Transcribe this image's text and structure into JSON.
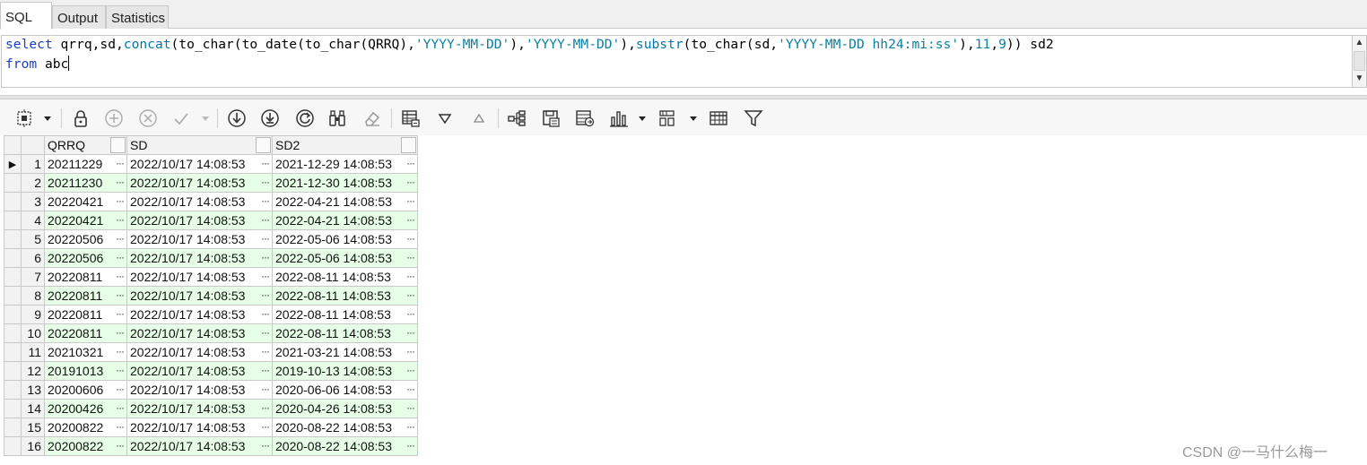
{
  "tabs": [
    {
      "label": "SQL",
      "active": true
    },
    {
      "label": "Output",
      "active": false
    },
    {
      "label": "Statistics",
      "active": false
    }
  ],
  "editor": {
    "line1_tokens": [
      {
        "t": "select",
        "c": "kw"
      },
      {
        "t": " qrrq,sd,",
        "c": ""
      },
      {
        "t": "concat",
        "c": "fn"
      },
      {
        "t": "(to_char(to_date(to_char(QRRQ),",
        "c": ""
      },
      {
        "t": "'YYYY-MM-DD'",
        "c": "str"
      },
      {
        "t": "),",
        "c": ""
      },
      {
        "t": "'YYYY-MM-DD'",
        "c": "str"
      },
      {
        "t": "),",
        "c": ""
      },
      {
        "t": "substr",
        "c": "fn"
      },
      {
        "t": "(to_char(sd,",
        "c": ""
      },
      {
        "t": "'YYYY-MM-DD hh24:mi:ss'",
        "c": "str"
      },
      {
        "t": "),",
        "c": ""
      },
      {
        "t": "11",
        "c": "str"
      },
      {
        "t": ",",
        "c": ""
      },
      {
        "t": "9",
        "c": "str"
      },
      {
        "t": ")) sd2",
        "c": ""
      }
    ],
    "line2_tokens": [
      {
        "t": "from",
        "c": "kw"
      },
      {
        "t": " abc",
        "c": ""
      }
    ]
  },
  "toolbar_icons": [
    "select-rows-icon",
    "dropdown-arrow-icon",
    "lock-icon",
    "add-record-icon",
    "delete-record-icon",
    "post-changes-icon",
    "dropdown-arrow-icon",
    "fetch-next-icon",
    "fetch-all-icon",
    "refresh-icon",
    "query-by-example-icon",
    "clear-icon",
    "grid-view-icon",
    "filter-down-icon",
    "filter-up-icon",
    "tree-view-icon",
    "save-grid-icon",
    "export-icon",
    "chart-icon",
    "dropdown-arrow-icon",
    "layout-icon",
    "dropdown-arrow-icon",
    "table-icon",
    "filter-icon"
  ],
  "grid": {
    "columns": [
      "QRRQ",
      "SD",
      "SD2"
    ],
    "current_row_marker": "▶",
    "cell_button": "···",
    "rows": [
      {
        "n": "1",
        "qrrq": "20211229",
        "sd": "2022/10/17 14:08:53",
        "sd2": "2021-12-29 14:08:53"
      },
      {
        "n": "2",
        "qrrq": "20211230",
        "sd": "2022/10/17 14:08:53",
        "sd2": "2021-12-30 14:08:53"
      },
      {
        "n": "3",
        "qrrq": "20220421",
        "sd": "2022/10/17 14:08:53",
        "sd2": "2022-04-21 14:08:53"
      },
      {
        "n": "4",
        "qrrq": "20220421",
        "sd": "2022/10/17 14:08:53",
        "sd2": "2022-04-21 14:08:53"
      },
      {
        "n": "5",
        "qrrq": "20220506",
        "sd": "2022/10/17 14:08:53",
        "sd2": "2022-05-06 14:08:53"
      },
      {
        "n": "6",
        "qrrq": "20220506",
        "sd": "2022/10/17 14:08:53",
        "sd2": "2022-05-06 14:08:53"
      },
      {
        "n": "7",
        "qrrq": "20220811",
        "sd": "2022/10/17 14:08:53",
        "sd2": "2022-08-11 14:08:53"
      },
      {
        "n": "8",
        "qrrq": "20220811",
        "sd": "2022/10/17 14:08:53",
        "sd2": "2022-08-11 14:08:53"
      },
      {
        "n": "9",
        "qrrq": "20220811",
        "sd": "2022/10/17 14:08:53",
        "sd2": "2022-08-11 14:08:53"
      },
      {
        "n": "10",
        "qrrq": "20220811",
        "sd": "2022/10/17 14:08:53",
        "sd2": "2022-08-11 14:08:53"
      },
      {
        "n": "11",
        "qrrq": "20210321",
        "sd": "2022/10/17 14:08:53",
        "sd2": "2021-03-21 14:08:53"
      },
      {
        "n": "12",
        "qrrq": "20191013",
        "sd": "2022/10/17 14:08:53",
        "sd2": "2019-10-13 14:08:53"
      },
      {
        "n": "13",
        "qrrq": "20200606",
        "sd": "2022/10/17 14:08:53",
        "sd2": "2020-06-06 14:08:53"
      },
      {
        "n": "14",
        "qrrq": "20200426",
        "sd": "2022/10/17 14:08:53",
        "sd2": "2020-04-26 14:08:53"
      },
      {
        "n": "15",
        "qrrq": "20200822",
        "sd": "2022/10/17 14:08:53",
        "sd2": "2020-08-22 14:08:53"
      },
      {
        "n": "16",
        "qrrq": "20200822",
        "sd": "2022/10/17 14:08:53",
        "sd2": "2020-08-22 14:08:53"
      }
    ]
  },
  "watermark": "CSDN @一马什么梅一",
  "colors": {
    "alt_row": "#e6ffe6",
    "keyword": "#1a3fc1",
    "string": "#0a7fa0"
  }
}
